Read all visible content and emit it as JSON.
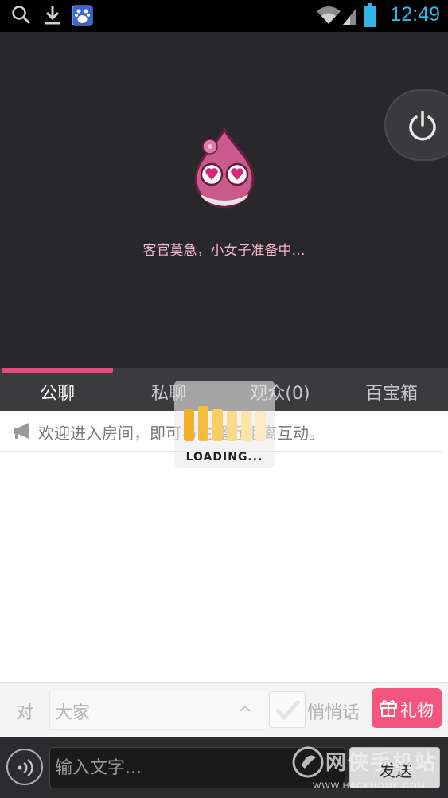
{
  "status_bar": {
    "time": "12:49",
    "icons": [
      "search-icon",
      "download-icon",
      "baidu-icon",
      "wifi-icon",
      "signal-icon",
      "battery-icon"
    ],
    "time_color": "#33b5e5"
  },
  "video": {
    "waiting_text": "客官莫急，小女子准备中…",
    "power_icon": "power-icon"
  },
  "tabs": [
    {
      "label": "公聊",
      "active": true
    },
    {
      "label": "私聊",
      "active": false
    },
    {
      "label": "观众(0)",
      "active": false
    },
    {
      "label": "百宝箱",
      "active": false
    }
  ],
  "chat": {
    "announcement": "欢迎进入房间，即可与主播近距离互动。",
    "announcement_icon": "megaphone-icon"
  },
  "loading": {
    "text": "LOADING..."
  },
  "target_row": {
    "to_label": "对",
    "target_value": "大家",
    "whisper_label": "悄悄话",
    "gift_label": "礼物"
  },
  "input_bar": {
    "placeholder": "输入文字...",
    "send_label": "发送"
  },
  "watermark": {
    "text": "网侠手机站",
    "url": "WWW.HACKHOME.COM"
  },
  "colors": {
    "accent": "#e84a78",
    "gift": "#f4557f",
    "video_bg": "#28272a",
    "tabs_bg": "#3b3a3d"
  }
}
